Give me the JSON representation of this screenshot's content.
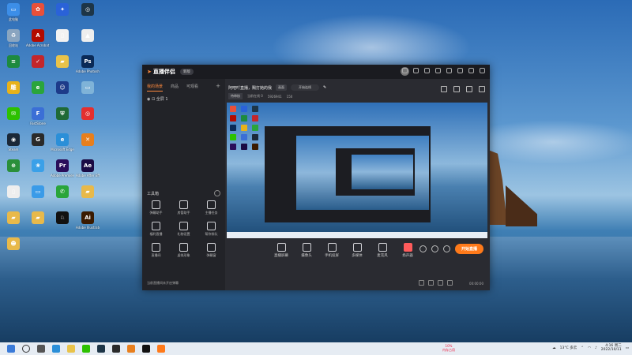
{
  "colors": {
    "accent": "#ff7a1a",
    "app_bg": "#1c1d22",
    "taskbar": "#e6ecf3"
  },
  "desktop": {
    "icons": [
      {
        "label": "此电脑",
        "color": "#3c8ee8",
        "glyph": "▭"
      },
      {
        "label": "",
        "color": "#e8503a",
        "glyph": "✿"
      },
      {
        "label": "",
        "color": "#2a62d8",
        "glyph": "✦"
      },
      {
        "label": "",
        "color": "#1d3547",
        "glyph": "◎"
      },
      {
        "label": "回收站",
        "color": "#8aa5c0",
        "glyph": "♻"
      },
      {
        "label": "Adobe Acrobat DC",
        "color": "#b30b00",
        "glyph": "A"
      },
      {
        "label": "",
        "color": "#f2f2f2",
        "glyph": "▯"
      },
      {
        "label": "",
        "color": "#eee",
        "glyph": "▲"
      },
      {
        "label": "",
        "color": "#1d8a3f",
        "glyph": "≡"
      },
      {
        "label": "",
        "color": "#c3262b",
        "glyph": "✓"
      },
      {
        "label": "",
        "color": "#e9c34a",
        "glyph": "▰"
      },
      {
        "label": "Adobe Photoshop",
        "color": "#0a2a57",
        "glyph": "Ps"
      },
      {
        "label": "",
        "color": "#e8b21a",
        "glyph": "雕"
      },
      {
        "label": "",
        "color": "#2aa53b",
        "glyph": "e"
      },
      {
        "label": "",
        "color": "#1d3b8a",
        "glyph": "☺"
      },
      {
        "label": "",
        "color": "#7fb3d8",
        "glyph": "▭"
      },
      {
        "label": "",
        "color": "#2dc100",
        "glyph": "✉"
      },
      {
        "label": "FastStone",
        "color": "#3b6fd6",
        "glyph": "F"
      },
      {
        "label": "",
        "color": "#1f6a36",
        "glyph": "⛨"
      },
      {
        "label": "",
        "color": "#e42f2f",
        "glyph": "◎"
      },
      {
        "label": "Steam",
        "color": "#1b2838",
        "glyph": "◉"
      },
      {
        "label": "",
        "color": "#2a2a2a",
        "glyph": "G"
      },
      {
        "label": "Microsoft Edge",
        "color": "#2b8fd8",
        "glyph": "e"
      },
      {
        "label": "",
        "color": "#e87f1d",
        "glyph": "✕"
      },
      {
        "label": "",
        "color": "#2a8f3a",
        "glyph": "⊕"
      },
      {
        "label": "",
        "color": "#3aa0e8",
        "glyph": "❀"
      },
      {
        "label": "Adobe Premiere",
        "color": "#2a0e5a",
        "glyph": "Pr"
      },
      {
        "label": "Adobe After Effects",
        "color": "#1a0a44",
        "glyph": "Ae"
      },
      {
        "label": "",
        "color": "#eee",
        "glyph": "▯"
      },
      {
        "label": "",
        "color": "#3a9be8",
        "glyph": "▭"
      },
      {
        "label": "",
        "color": "#2aa53b",
        "glyph": "✆"
      },
      {
        "label": "",
        "color": "#e8b94a",
        "glyph": "▰"
      },
      {
        "label": "",
        "color": "#e8b94a",
        "glyph": "▰"
      },
      {
        "label": "",
        "color": "#e8b94a",
        "glyph": "▰"
      },
      {
        "label": "",
        "color": "#111",
        "glyph": "♘"
      },
      {
        "label": "Adobe Illustrator",
        "color": "#3a1a00",
        "glyph": "Ai"
      },
      {
        "label": "",
        "color": "#e8b94a",
        "glyph": "☻"
      }
    ]
  },
  "app": {
    "brand": "直播伴侣",
    "version": "新版",
    "sidebar": {
      "tabs": [
        "我的场景",
        "商品",
        "可观看"
      ],
      "scene": "全屏 1",
      "tools_title": "工具箱",
      "tools": [
        "弹幕助手",
        "房管助手",
        "主播任务",
        "福利直播",
        "礼物设置",
        "帮你排队",
        "直播间",
        "虚拟形象",
        "弹幕窗"
      ],
      "tip": "当前直播间未开启弹幕"
    },
    "info": {
      "title": "阿吧吖直播，赐打她的我",
      "chip": "画面",
      "pill": "开始连线",
      "tag": "待审核",
      "stat1": "当前在线 0",
      "stat2": "5926941",
      "stat3": "150"
    },
    "controls": {
      "buttons": [
        "直播屏幕",
        "摄像头",
        "手机投屏",
        "多媒体",
        "麦克风",
        "扬声器"
      ],
      "go_live": "开始直播",
      "timer": "00:00:00"
    }
  },
  "taskbar": {
    "weather": "13°C 多云",
    "time": "4:16 周二",
    "date": "2022/10/11",
    "net_value": "10%",
    "net_label": "内存占用"
  }
}
